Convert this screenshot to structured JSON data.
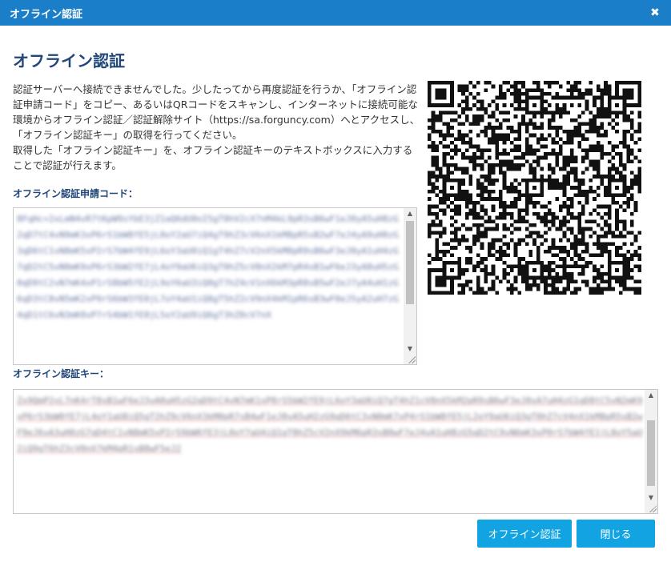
{
  "window": {
    "title": "オフライン認証",
    "close_glyph": "✖"
  },
  "heading": "オフライン認証",
  "description": {
    "line1": "認証サーバーへ接続できませんでした。少したってから再度認証を行うか、「オフライン認証申請コード」をコピー、あるいはQRコードをスキャンし、インターネットに接続可能な環境からオフライン認証／認証解除サイト（https://sa.forguncy.com）へとアクセスし、「オフライン認証キー」の取得を行ってください。",
    "line2": "取得した「オフライン認証キー」を、オフライン認証キーのテキストボックスに入力することで認証が行えます。"
  },
  "request_code": {
    "label": "オフライン認証申請コード：",
    "value": "8FqHc+2xLmN4vR7tKpW9sYbE3jZ1aQ6dU0oI5gT8hV2cX7nM4kL9pR3sB6wF1eJ0yA5uH8zG2qD7tC4vN9mK3xP6rS1bW8fE5jL0oY2aU7iQ4gT9hZ3cV6nX1kM8pR5sB2wF7eJ4yA9uH0zG3qD6tC1vN8mK5xP2rS7bW4fE9jL6oY3aU0iQ1gT4hZ7cV2nX5kM0pR9sB6wF3eJ8yA1uH4zG7qD2tC5vN0mK9xP6rS3bW2fE7jL4oY9aU6iQ3gT0hZ5cV8nX2kM7pR4sB1wF6eJ3yA8uH5zG0qD9tC2vN7mK4xP1rS8bW5fE2jL9oY6aU3iQ0gT7hZ4cV1nX6kM3pR8sB5wF2eJ7yA4uH1zG6qD3tC8vN5mK2xP9rS6bW3fE0jL7oY4aU1iQ8gT5hZ2cV9nX4kM1pR6sB3wF0eJ5yA2uH7zG4qD1tC6vN3mK0xP7rS4bW1fE8jL5oY2aU9iQ6gT3hZ0cV7nX"
  },
  "auth_key": {
    "label": "オフライン認証キー：",
    "value": "Zx9QmP2vL7nK4rT8sB1wF6eJ3yA0uH5zG2qD9tC4vN7mK1xP8rS5bW2fE9jL6oY3aU0iQ7gT4hZ1cV8nX5kM2pR9sB6wF3eJ0yA7uH4zG1qD8tC5vN2mK9xP6rS3bW0fE7jL4oY1aU8iQ5gT2hZ9cV6nX3kM0pR7sB4wF1eJ8yA5uH2zG9qD6tC3vN0mK7xP4rS1bW8fE5jL2oY9aU6iQ3gT0hZ7cV4nX1kM8pR5sB2wF9eJ6yA3uH0zG7qD4tC1vN8mK5xP2rS9bW6fE3jL0oY7aU4iQ1gT8hZ5cV2nX9kM6pR3sB0wF7eJ4yA1uH8zG5qD2tC9vN6mK3xP0rS7bW4fE1jL8oY5aU2iQ9gT6hZ3cV0nX7kM4pR1sB8wF5eJ2"
  },
  "buttons": {
    "authenticate": "オフライン認証",
    "close": "閉じる"
  },
  "qr_icon": "qr-code",
  "colors": {
    "titlebar": "#1a7fc8",
    "heading": "#20467a",
    "button": "#12a3e2"
  }
}
